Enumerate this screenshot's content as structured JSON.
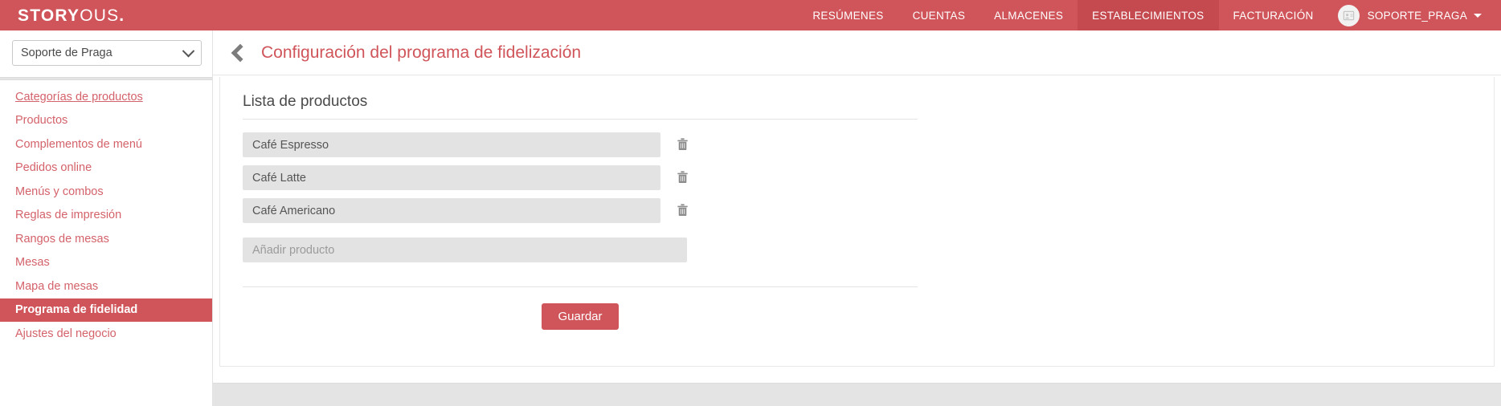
{
  "colors": {
    "brand_red": "#d0555a",
    "brand_red_active": "#c44a50",
    "link_red": "#d4626a",
    "field_gray": "#e3e3e3",
    "text_gray": "#4a4a4a"
  },
  "topbar": {
    "logo_bold": "STORY",
    "logo_light": "OUS",
    "logo_dot": ".",
    "nav_items": [
      {
        "label": "RESÚMENES",
        "active": false
      },
      {
        "label": "CUENTAS",
        "active": false
      },
      {
        "label": "ALMACENES",
        "active": false
      },
      {
        "label": "ESTABLECIMIENTOS",
        "active": true
      },
      {
        "label": "FACTURACIÓN",
        "active": false
      }
    ],
    "user": {
      "name": "SOPORTE_PRAGA",
      "avatar_icon": "user-id-card-icon",
      "caret_icon": "caret-down-icon"
    }
  },
  "sidebar": {
    "business_select": {
      "value": "Soporte de Praga",
      "chevron_icon": "chevron-down-icon"
    },
    "items": [
      {
        "label": "Categorías de productos",
        "state": "hover"
      },
      {
        "label": "Productos",
        "state": "normal"
      },
      {
        "label": "Complementos de menú",
        "state": "normal"
      },
      {
        "label": "Pedidos online",
        "state": "normal"
      },
      {
        "label": "Menús y combos",
        "state": "normal"
      },
      {
        "label": "Reglas de impresión",
        "state": "normal"
      },
      {
        "label": "Rangos de mesas",
        "state": "normal"
      },
      {
        "label": "Mesas",
        "state": "normal"
      },
      {
        "label": "Mapa de mesas",
        "state": "normal"
      },
      {
        "label": "Programa de fidelidad",
        "state": "active"
      },
      {
        "label": "Ajustes del negocio",
        "state": "normal"
      }
    ]
  },
  "page": {
    "back_icon": "chevron-left-icon",
    "title": "Configuración del programa de fidelización"
  },
  "main": {
    "section_title": "Lista de productos",
    "products": [
      {
        "value": "Café Espresso",
        "delete_icon": "trash-icon"
      },
      {
        "value": "Café Latte",
        "delete_icon": "trash-icon"
      },
      {
        "value": "Café Americano",
        "delete_icon": "trash-icon"
      }
    ],
    "add_product": {
      "value": "",
      "placeholder": "Añadir producto"
    },
    "save_label": "Guardar"
  }
}
